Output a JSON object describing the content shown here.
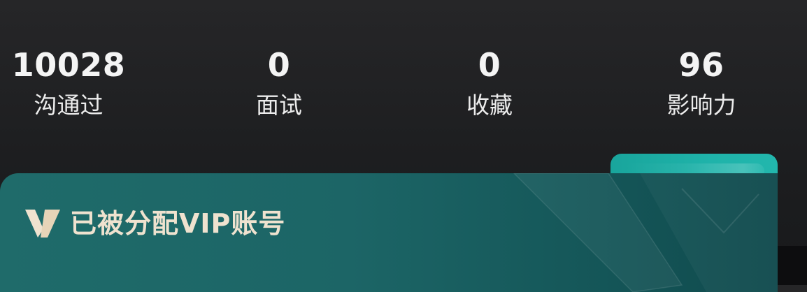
{
  "stats": [
    {
      "value": "10028",
      "label": "沟通过"
    },
    {
      "value": "0",
      "label": "面试"
    },
    {
      "value": "0",
      "label": "收藏"
    },
    {
      "value": "96",
      "label": "影响力"
    }
  ],
  "vip_banner": {
    "title": "已被分配VIP账号",
    "logo_icon": "vip-v-icon",
    "accent_color": "#efe2cf",
    "background_color": "#1c6566",
    "tab_color": "#1fb3aa"
  }
}
